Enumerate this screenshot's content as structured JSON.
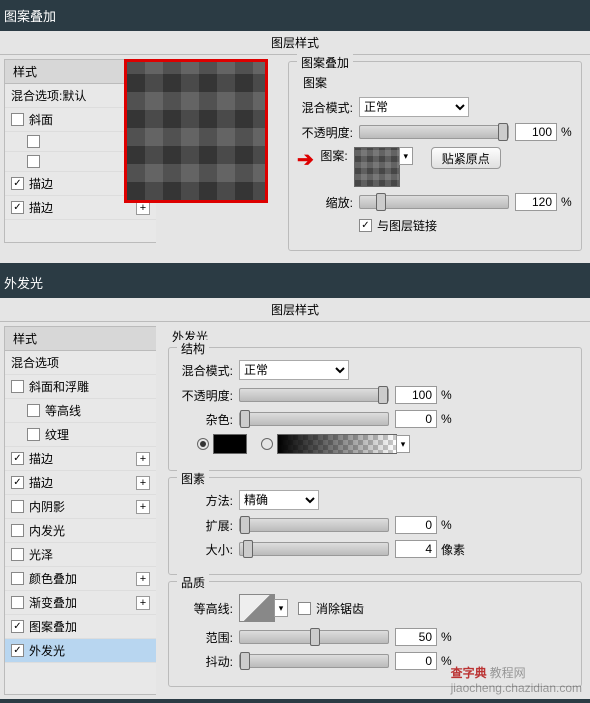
{
  "section1": {
    "label": "图案叠加"
  },
  "section2": {
    "label": "外发光"
  },
  "dialog_title": "图层样式",
  "watermark": {
    "a": "查字典",
    "b": "教程网",
    "c": "jiaocheng.chazidian.com"
  },
  "styles": {
    "header": "样式",
    "blending": "混合选项:默认",
    "blending2": "混合选项",
    "bevel": "斜面和浮雕",
    "bevel_short": "斜面",
    "contour": "等高线",
    "texture": "纹理",
    "stroke": "描边",
    "inner_shadow": "内阴影",
    "inner_glow": "内发光",
    "satin": "光泽",
    "color_overlay": "颜色叠加",
    "gradient_overlay": "渐变叠加",
    "pattern_overlay": "图案叠加",
    "outer_glow": "外发光"
  },
  "pattern_overlay": {
    "title": "图案叠加",
    "pattern_group": "图案",
    "blend_mode_label": "混合模式:",
    "blend_mode_value": "正常",
    "opacity_label": "不透明度:",
    "opacity_value": "100",
    "pct": "%",
    "pattern_label": "图案:",
    "snap_btn": "贴紧原点",
    "scale_label": "缩放:",
    "scale_value": "120",
    "link_label": "与图层链接"
  },
  "outer_glow": {
    "title": "外发光",
    "structure": "结构",
    "blend_mode_label": "混合模式:",
    "blend_mode_value": "正常",
    "opacity_label": "不透明度:",
    "opacity_value": "100",
    "pct": "%",
    "noise_label": "杂色:",
    "noise_value": "0",
    "elements": "图素",
    "method_label": "方法:",
    "method_value": "精确",
    "spread_label": "扩展:",
    "spread_value": "0",
    "size_label": "大小:",
    "size_value": "4",
    "px": "像素",
    "quality": "品质",
    "contour_label": "等高线:",
    "anti_alias": "消除锯齿",
    "range_label": "范围:",
    "range_value": "50",
    "jitter_label": "抖动:",
    "jitter_value": "0"
  }
}
